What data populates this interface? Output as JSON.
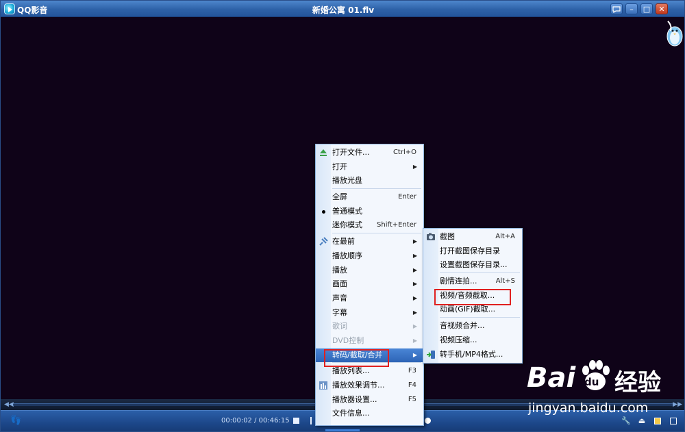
{
  "app": {
    "name": "QQ影音",
    "title": "新婚公寓 01.flv"
  },
  "window_buttons": {
    "chat": "▭",
    "minimize": "–",
    "maximize": "□",
    "close": "✕"
  },
  "player": {
    "current_time": "00:00:02",
    "total_time": "00:46:15",
    "time_sep": " / "
  },
  "main_menu": {
    "items": [
      {
        "label": "打开文件...",
        "shortcut": "Ctrl+O",
        "icon": "eject-icon"
      },
      {
        "label": "打开",
        "submenu": true
      },
      {
        "label": "播放光盘"
      },
      {
        "label": "全屏",
        "shortcut": "Enter"
      },
      {
        "label": "普通模式",
        "checked": true
      },
      {
        "label": "迷你模式",
        "shortcut": "Shift+Enter"
      },
      {
        "label": "在最前",
        "submenu": true,
        "icon": "pin-icon"
      },
      {
        "label": "播放顺序",
        "submenu": true
      },
      {
        "label": "播放",
        "submenu": true
      },
      {
        "label": "画面",
        "submenu": true
      },
      {
        "label": "声音",
        "submenu": true
      },
      {
        "label": "字幕",
        "submenu": true
      },
      {
        "label": "歌词",
        "submenu": true,
        "disabled": true
      },
      {
        "label": "DVD控制",
        "submenu": true,
        "disabled": true
      },
      {
        "label": "转码/截取/合并",
        "submenu": true,
        "highlighted": true
      },
      {
        "label": "播放列表...",
        "shortcut": "F3"
      },
      {
        "label": "播放效果调节...",
        "shortcut": "F4",
        "icon": "equalizer-icon"
      },
      {
        "label": "播放器设置...",
        "shortcut": "F5"
      },
      {
        "label": "文件信息..."
      }
    ]
  },
  "sub_menu": {
    "items": [
      {
        "label": "截图",
        "shortcut": "Alt+A",
        "icon": "camera-icon"
      },
      {
        "label": "打开截图保存目录"
      },
      {
        "label": "设置截图保存目录..."
      },
      {
        "label": "剧情连拍...",
        "shortcut": "Alt+S"
      },
      {
        "label": "视频/音频截取..."
      },
      {
        "label": "动画(GIF)截取..."
      },
      {
        "label": "音视频合并..."
      },
      {
        "label": "视频压缩..."
      },
      {
        "label": "转手机/MP4格式...",
        "icon": "phone-convert-icon"
      }
    ]
  },
  "watermark": {
    "brand_left": "Bai",
    "brand_right": "经验",
    "paw_char": "du",
    "url": "jingyan.baidu.com"
  },
  "colors": {
    "title_bar": "#2e62a8",
    "video_bg": "#0f0318",
    "menu_bg": "#f3f7fd",
    "highlight": "#2d64b6",
    "annotation_red": "#e02020"
  }
}
